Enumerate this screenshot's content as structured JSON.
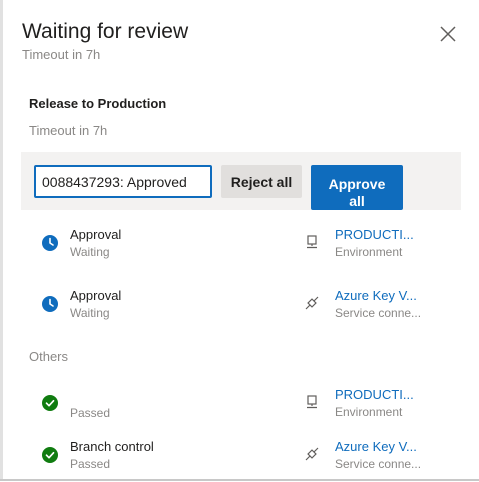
{
  "dialog": {
    "title": "Waiting for review",
    "subtitle": "Timeout in 7h"
  },
  "stage": {
    "title": "Release to Production",
    "timeout": "Timeout in 7h"
  },
  "actions": {
    "comment_value": "0088437293: Approved",
    "reject_label": "Reject all",
    "approve_label_line1": "Approve",
    "approve_label_line2": "all"
  },
  "pending_checks": [
    {
      "name": "Approval",
      "status": "Waiting",
      "resource": "PRODUCTI...",
      "resource_type": "Environment",
      "status_icon": "clock-icon",
      "resource_icon": "environment-icon"
    },
    {
      "name": "Approval",
      "status": "Waiting",
      "resource": "Azure Key V...",
      "resource_type": "Service conne...",
      "status_icon": "clock-icon",
      "resource_icon": "plug-icon"
    }
  ],
  "others": {
    "label": "Others",
    "checks": [
      {
        "name": "",
        "status": "Passed",
        "resource": "PRODUCTI...",
        "resource_type": "Environment",
        "status_icon": "check-circle-icon",
        "resource_icon": "environment-icon"
      },
      {
        "name": "Branch control",
        "status": "Passed",
        "resource": "Azure Key V...",
        "resource_type": "Service conne...",
        "status_icon": "check-circle-icon",
        "resource_icon": "plug-icon"
      }
    ]
  },
  "colors": {
    "accent": "#0f6cbd",
    "waiting": "#0f6cbd",
    "passed": "#107c10",
    "muted": "#8a8886"
  }
}
